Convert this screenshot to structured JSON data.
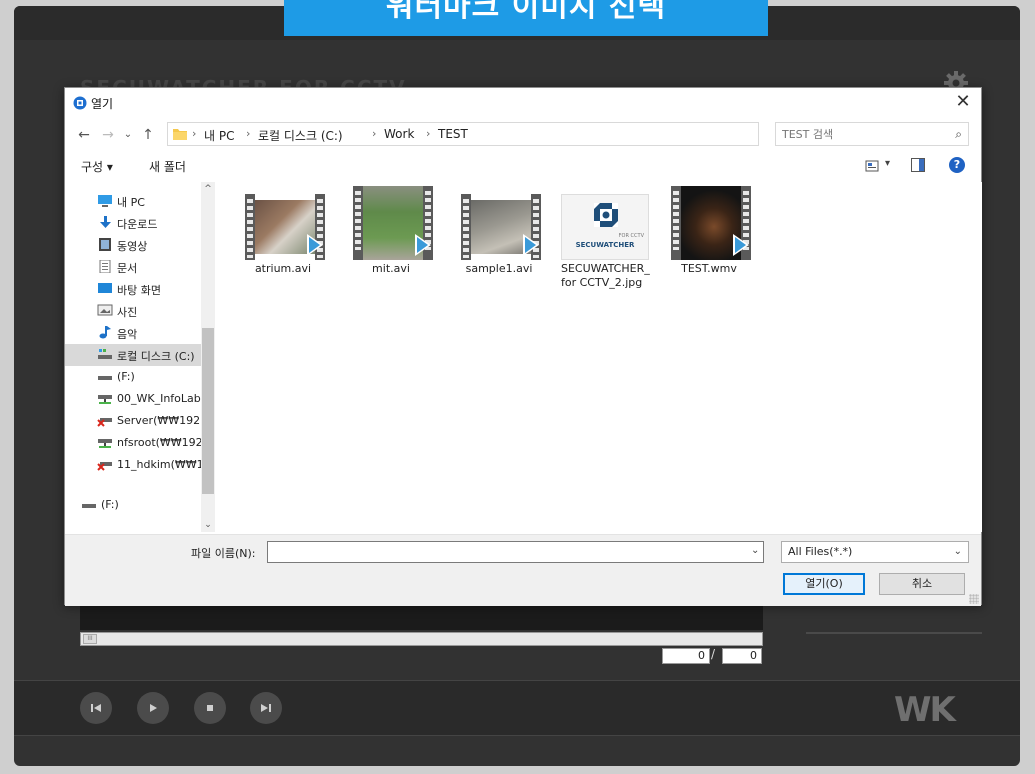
{
  "banner": {
    "text": "워터마크 이미지 선택"
  },
  "app": {
    "logo_text": "SECUWATCHER FOR CCTV",
    "brand_logo": "WK",
    "frame_current": "0",
    "frame_total": "0",
    "frame_separator": "/",
    "seek_thumb": "III",
    "controls": [
      "previous-icon",
      "play-icon",
      "stop-icon",
      "next-icon"
    ]
  },
  "dialog": {
    "title": "열기",
    "close": "✕",
    "nav": {
      "back": "←",
      "forward": "→",
      "recent": "⌄",
      "up": "↑"
    },
    "breadcrumb": [
      "내 PC",
      "로컬 디스크 (C:)",
      "Work",
      "TEST"
    ],
    "breadcrumb_separator": "›",
    "address_dropdown": "⌄",
    "refresh": "↻",
    "search_placeholder": "TEST 검색",
    "search_icon": "⌕",
    "toolbar": {
      "organize": "구성 ▾",
      "new_folder": "새 폴더",
      "view_arrow": "▾",
      "help": "?"
    },
    "nav_pane": {
      "scroll_up": "^",
      "scroll_down": "⌄",
      "items": [
        {
          "label": "내 PC",
          "icon": "pc-icon"
        },
        {
          "label": "다운로드",
          "icon": "download-icon"
        },
        {
          "label": "동영상",
          "icon": "video-icon"
        },
        {
          "label": "문서",
          "icon": "document-icon"
        },
        {
          "label": "바탕 화면",
          "icon": "desktop-icon"
        },
        {
          "label": "사진",
          "icon": "picture-icon"
        },
        {
          "label": "음악",
          "icon": "music-icon"
        },
        {
          "label": "로컬 디스크 (C:)",
          "icon": "local-disk-icon",
          "selected": true
        },
        {
          "label": "(F:)",
          "icon": "drive-icon"
        },
        {
          "label": "00_WK_InfoLab(",
          "icon": "network-drive-icon"
        },
        {
          "label": "Server(₩₩192.1",
          "icon": "disconnected-drive-icon"
        },
        {
          "label": "nfsroot(₩₩192.",
          "icon": "network-drive-icon"
        },
        {
          "label": "11_hdkim(₩₩19",
          "icon": "disconnected-drive-icon"
        },
        {
          "label": "(F:)",
          "icon": "drive-icon"
        }
      ]
    },
    "files": [
      {
        "name": "atrium.avi",
        "type": "video"
      },
      {
        "name": "mit.avi",
        "type": "video"
      },
      {
        "name": "sample1.avi",
        "type": "video"
      },
      {
        "name": "SECUWATCHER_for CCTV_2.jpg",
        "type": "image",
        "logo_text": "SECUWATCHER",
        "logo_sub": "FOR CCTV"
      },
      {
        "name": "TEST.wmv",
        "type": "video"
      }
    ],
    "filename_label": "파일 이름(N):",
    "filename_value": "",
    "filename_dropdown": "⌄",
    "filetype": "All Files(*.*)",
    "filetype_arrow": "⌄",
    "open_label": "열기(O)",
    "cancel_label": "취소"
  },
  "colors": {
    "banner": "#1e9be6",
    "selection": "#d9d9d9",
    "accent": "#0078d7",
    "play_overlay": "#3a9ad9"
  }
}
